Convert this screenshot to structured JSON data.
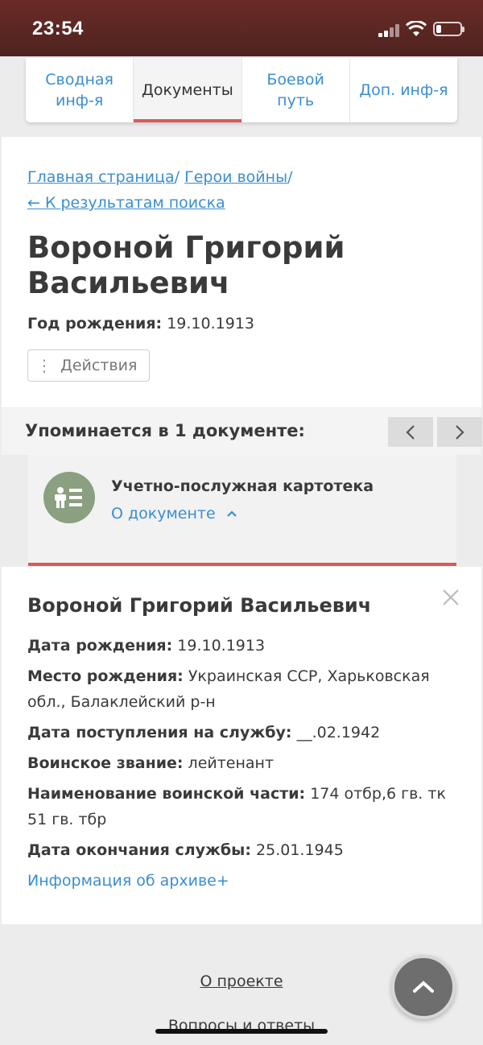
{
  "status": {
    "time": "23:54"
  },
  "tabs": [
    {
      "label": "Сводная инф-я"
    },
    {
      "label": "Документы"
    },
    {
      "label": "Боевой путь"
    },
    {
      "label": "Доп. инф-я"
    }
  ],
  "breadcrumb": {
    "home": "Главная страница",
    "heroes": "Герои войны",
    "sep": "/"
  },
  "back_link": "← К результатам поиска",
  "person": {
    "name": "Вороной Григорий Васильевич",
    "birth_label": "Год рождения:",
    "birth_value": "19.10.1913"
  },
  "actions_label": "Действия",
  "mentions": {
    "title": "Упоминается в 1 документе:"
  },
  "document": {
    "title": "Учетно-послужная картотека",
    "about_label": "О документе"
  },
  "details": {
    "name": "Вороной Григорий Васильевич",
    "fields": [
      {
        "label": "Дата рождения:",
        "value": "19.10.1913"
      },
      {
        "label": "Место рождения:",
        "value": "Украинская ССР, Харьковская обл., Балаклейский р-н"
      },
      {
        "label": "Дата поступления на службу:",
        "value": "__.02.1942"
      },
      {
        "label": "Воинское звание:",
        "value": "лейтенант"
      },
      {
        "label": "Наименование воинской части:",
        "value": "174 отбр,6 гв. тк 51 гв. тбр"
      },
      {
        "label": "Дата окончания службы:",
        "value": "25.01.1945"
      }
    ],
    "archive_link": "Информация об архиве+"
  },
  "footer": {
    "about": "О проекте",
    "faq": "Вопросы и ответы"
  },
  "colors": {
    "accent_red": "#e05757",
    "link_blue": "#3b8ed1",
    "status_bar": "#5a2622",
    "doc_icon_green": "#8aa080"
  }
}
